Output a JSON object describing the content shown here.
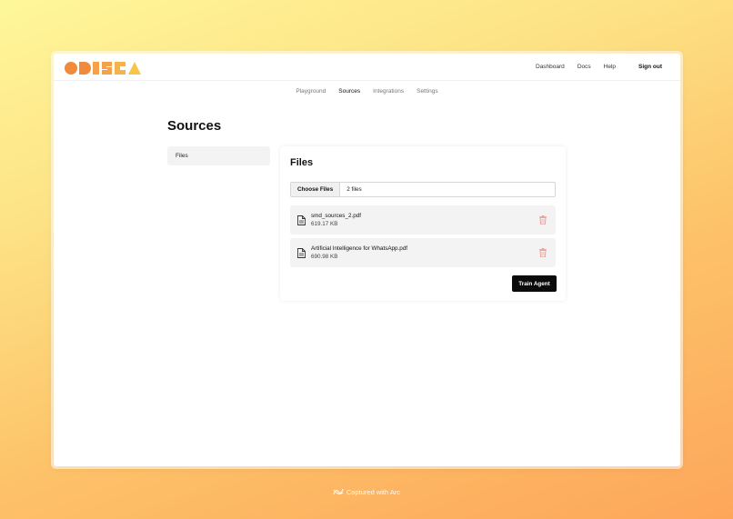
{
  "header": {
    "logo_text": "ODISEA",
    "nav": [
      "Dashboard",
      "Docs",
      "Help"
    ],
    "signout_label": "Sign out"
  },
  "subnav": {
    "tabs": [
      "Playground",
      "Sources",
      "Integrations",
      "Settings"
    ],
    "active": "Sources"
  },
  "page": {
    "title": "Sources",
    "side_tab": "Files"
  },
  "card": {
    "title": "Files",
    "choose_label": "Choose Files",
    "file_count": "2 files",
    "files": [
      {
        "name": "smd_sources_2.pdf",
        "size": "619.17 KB"
      },
      {
        "name": "Artificial Intelligence for WhatsApp.pdf",
        "size": "690.98 KB"
      }
    ],
    "train_label": "Train Agent"
  },
  "footer": {
    "captured_text": "Captured with Arc"
  },
  "colors": {
    "logo_orange": "#f08a3c",
    "logo_yellow": "#f7c548",
    "trash_red": "#f19a93",
    "button_black": "#0b0b0b"
  }
}
